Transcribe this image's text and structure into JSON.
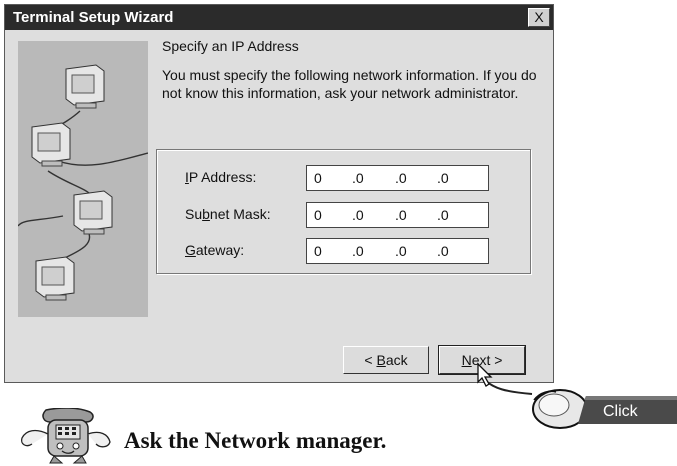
{
  "window": {
    "title": "Terminal Setup Wizard",
    "close_label": "X"
  },
  "content": {
    "heading": "Specify an IP Address",
    "description": "You must specify the following network information. If you do not know this information, ask your network administrator."
  },
  "fields": [
    {
      "label_pre": "",
      "label_key": "I",
      "label_post": "P Address:",
      "octets": [
        "0",
        ".0",
        ".0",
        ".0"
      ]
    },
    {
      "label_pre": "Su",
      "label_key": "b",
      "label_post": "net Mask:",
      "octets": [
        "0",
        ".0",
        ".0",
        ".0"
      ]
    },
    {
      "label_pre": "",
      "label_key": "G",
      "label_post": "ateway:",
      "octets": [
        "0",
        ".0",
        ".0",
        ".0"
      ]
    }
  ],
  "buttons": {
    "back": {
      "pre": "< ",
      "key": "B",
      "post": "ack"
    },
    "next": {
      "pre": "",
      "key": "N",
      "post": "ext >"
    }
  },
  "callout": {
    "label": "Click"
  },
  "footer": {
    "text": "Ask the Network manager."
  },
  "colors": {
    "titlebar": "#2b2b2b",
    "window_bg": "#dedede",
    "illustration_bg": "#b9b9b9"
  },
  "icons": [
    "computer-icon",
    "mouse-icon",
    "mouse-cursor-icon",
    "telephone-mascot-icon"
  ]
}
